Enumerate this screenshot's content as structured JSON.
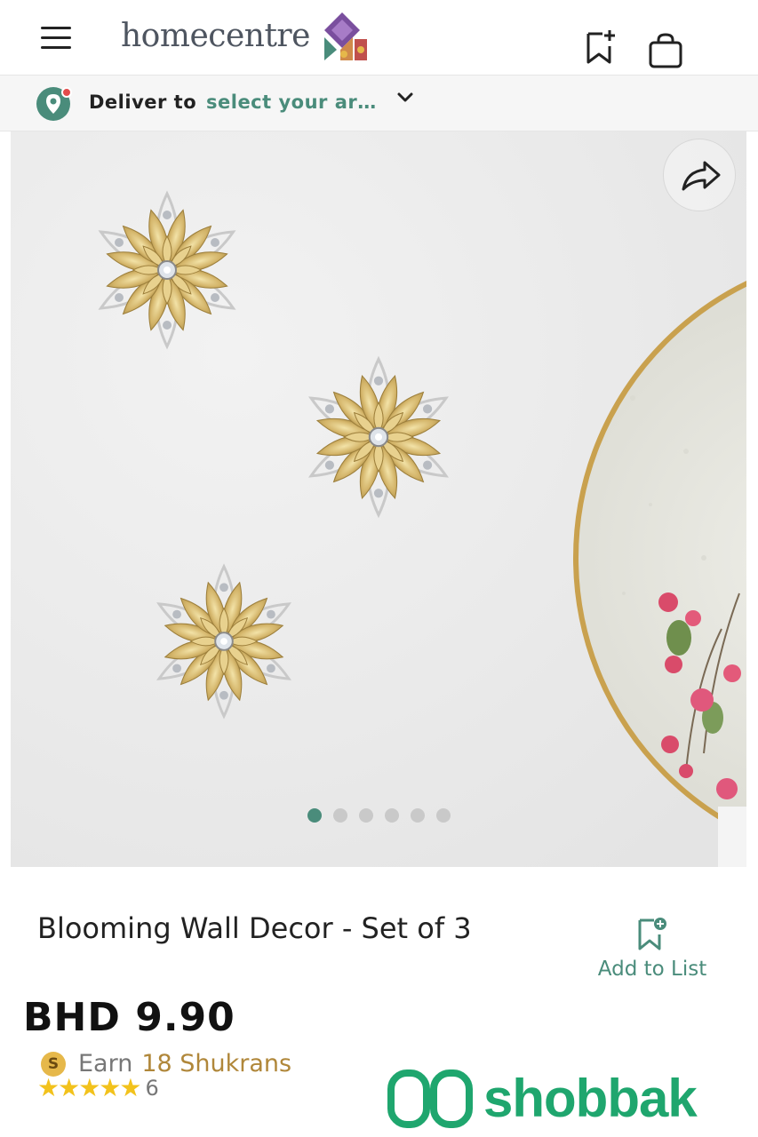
{
  "header": {
    "logo_text": "homecentre"
  },
  "delivery": {
    "label": "Deliver to",
    "area": "select your ar…"
  },
  "gallery": {
    "slide_count": 6,
    "active_index": 0
  },
  "product": {
    "title": "Blooming Wall Decor - Set of 3",
    "add_to_list_label": "Add to List",
    "price": "BHD 9.90",
    "earn_label": "Earn",
    "earn_amount": "18 Shukrans",
    "coin_letter": "S",
    "rating_stars": "★★★★★",
    "rating_value": 5,
    "rating_count": "6"
  },
  "watermark": {
    "text": "shobbak"
  },
  "colors": {
    "brand_green": "#4a8c7b",
    "star_yellow": "#f2c21c",
    "watermark_green": "#1fa66e",
    "shukran_gold": "#b0873a"
  },
  "icons": {
    "menu": "hamburger-menu-icon",
    "wishlist": "bookmark-plus-icon",
    "bag": "shopping-bag-icon",
    "location": "location-pin-icon",
    "dropdown": "chevron-down-icon",
    "share": "share-arrow-icon"
  }
}
